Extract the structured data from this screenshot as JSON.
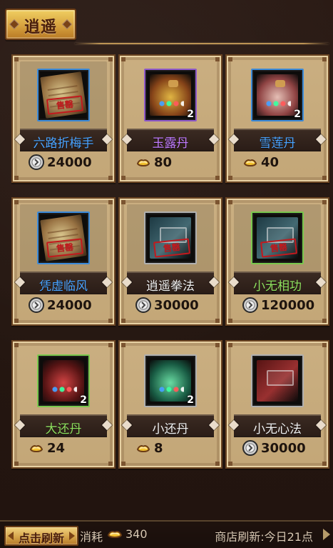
{
  "window": {
    "title": "逍遥"
  },
  "colors": {
    "bg": "#2b1a12",
    "card_bg": "#c7aa7a",
    "card_border": "#6a4422",
    "banner_bg": "#2b1d17",
    "name_blue": "#4aa3ff",
    "name_purple": "#c17cff",
    "name_white": "#f0f0f0",
    "name_green": "#8fe05f",
    "sold_red": "#c2191d",
    "gold": "#d6a54b"
  },
  "shop": {
    "items": [
      {
        "name": "六路折梅手",
        "name_color": "#4aa3ff",
        "quality": "blue",
        "icon": "scroll-icon",
        "sold_label": "售罄",
        "stack_count": "",
        "price": "24000",
        "currency_icon": "silver-coin-icon"
      },
      {
        "name": "玉露丹",
        "name_color": "#c17cff",
        "quality": "purple",
        "icon": "vase-icon",
        "sold_label": "",
        "stack_count": "2",
        "price": "80",
        "currency_icon": "gold-ingot-icon"
      },
      {
        "name": "雪莲丹",
        "name_color": "#4aa3ff",
        "quality": "blue",
        "icon": "vase-white-icon",
        "sold_label": "",
        "stack_count": "2",
        "price": "40",
        "currency_icon": "gold-ingot-icon"
      },
      {
        "name": "凭虚临风",
        "name_color": "#4aa3ff",
        "quality": "blue",
        "icon": "scroll-icon",
        "sold_label": "售罄",
        "stack_count": "",
        "price": "24000",
        "currency_icon": "silver-coin-icon"
      },
      {
        "name": "逍遥拳法",
        "name_color": "#f0f0f0",
        "quality": "gray",
        "icon": "book-icon",
        "sold_label": "售罄",
        "stack_count": "",
        "price": "30000",
        "currency_icon": "silver-coin-icon"
      },
      {
        "name": "小无相功",
        "name_color": "#8fe05f",
        "quality": "green",
        "icon": "book-icon",
        "sold_label": "售罄",
        "stack_count": "",
        "price": "120000",
        "currency_icon": "silver-coin-icon"
      },
      {
        "name": "大还丹",
        "name_color": "#8fe05f",
        "quality": "green",
        "icon": "potion-red-icon",
        "sold_label": "",
        "stack_count": "2",
        "price": "24",
        "currency_icon": "gold-ingot-icon"
      },
      {
        "name": "小还丹",
        "name_color": "#f0f0f0",
        "quality": "gray",
        "icon": "potion-green-icon",
        "sold_label": "",
        "stack_count": "2",
        "price": "8",
        "currency_icon": "gold-ingot-icon"
      },
      {
        "name": "小无心法",
        "name_color": "#f0f0f0",
        "quality": "gray",
        "icon": "book-red-icon",
        "sold_label": "",
        "stack_count": "",
        "price": "30000",
        "currency_icon": "silver-coin-icon"
      }
    ]
  },
  "footer": {
    "refresh_button_label": "点击刷新",
    "cost_label": "消耗",
    "cost_value": "340",
    "cost_icon": "gold-ingot-icon",
    "refresh_time": "商店刷新:今日21点"
  }
}
